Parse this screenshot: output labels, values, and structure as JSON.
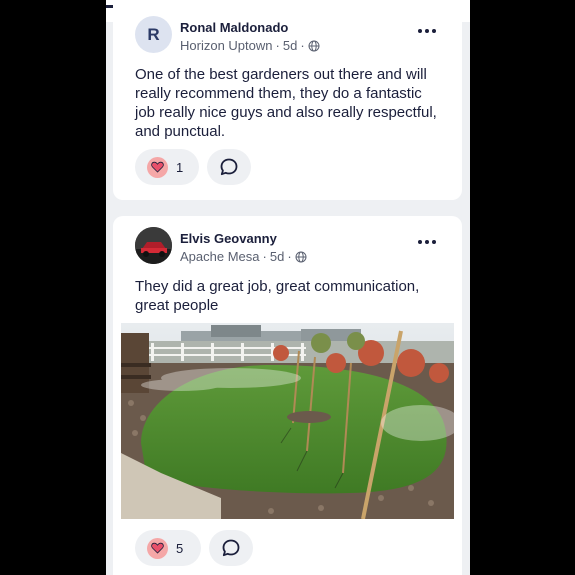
{
  "posts": [
    {
      "author": "Ronal Maldonado",
      "avatar_initial": "R",
      "neighborhood": "Horizon Uptown",
      "time": "5d",
      "separator": "·",
      "body": "One of the best gardeners out there and will really recommend them, they do a fantastic job really nice guys and also really respectful, and punctual.",
      "reactions": "1"
    },
    {
      "author": "Elvis Geovanny",
      "neighborhood": "Apache Mesa",
      "time": "5d",
      "separator": "·",
      "body": "They did a great job, great communication, great people",
      "reactions": "5"
    }
  ],
  "colors": {
    "heart": "#e8506a",
    "reaction_bg": "#f5a7a7",
    "text": "#1b1f3b"
  }
}
